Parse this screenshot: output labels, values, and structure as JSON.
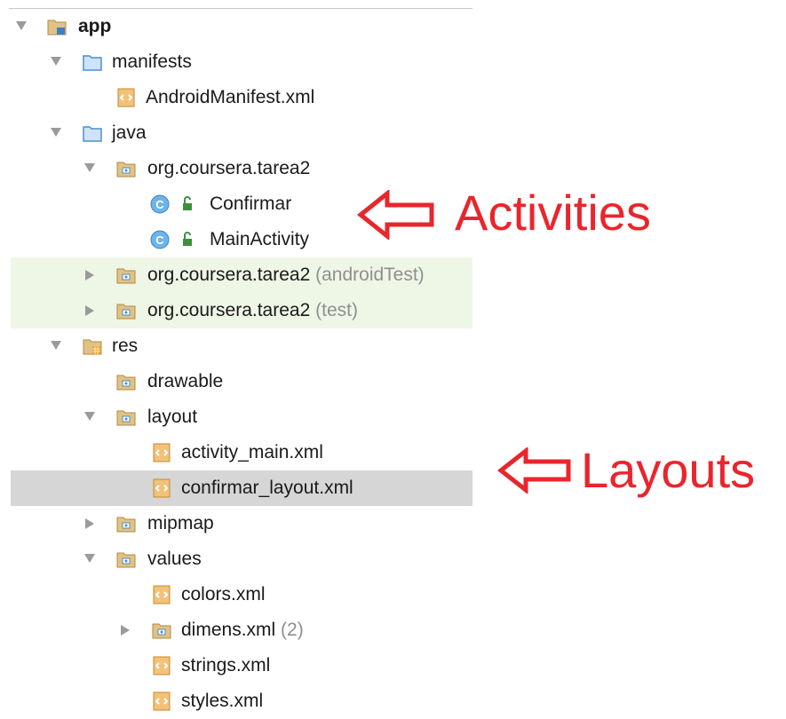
{
  "tree": {
    "app": "app",
    "manifests": "manifests",
    "android_manifest": "AndroidManifest.xml",
    "java": "java",
    "package_main": "org.coursera.tarea2",
    "class_confirmar": "Confirmar",
    "class_main_activity": "MainActivity",
    "package_android_test": "org.coursera.tarea2",
    "android_test_hint": "(androidTest)",
    "package_test": "org.coursera.tarea2",
    "test_hint": "(test)",
    "res": "res",
    "drawable": "drawable",
    "layout": "layout",
    "activity_main": "activity_main.xml",
    "confirmar_layout": "confirmar_layout.xml",
    "mipmap": "mipmap",
    "values": "values",
    "colors": "colors.xml",
    "dimens": "dimens.xml",
    "dimens_hint": "(2)",
    "strings": "strings.xml",
    "styles": "styles.xml"
  },
  "annotations": {
    "activities": "Activities",
    "layouts": "Layouts"
  },
  "colors": {
    "annotation_red": "#e8262c",
    "folder_tan": "#c9a566",
    "folder_blue": "#4a8fd0",
    "class_blue": "#5aa8e0",
    "lock_green": "#3d8f3d",
    "test_band": "#eef6e6",
    "selection": "#d6d6d6"
  },
  "icons": {
    "expanded": "triangle-down-icon",
    "collapsed": "triangle-right-icon",
    "module": "module-folder-icon",
    "folder": "folder-icon",
    "package": "package-icon",
    "xml": "xml-file-icon",
    "class": "class-icon",
    "lock": "unlock-icon",
    "res": "res-folder-icon"
  }
}
